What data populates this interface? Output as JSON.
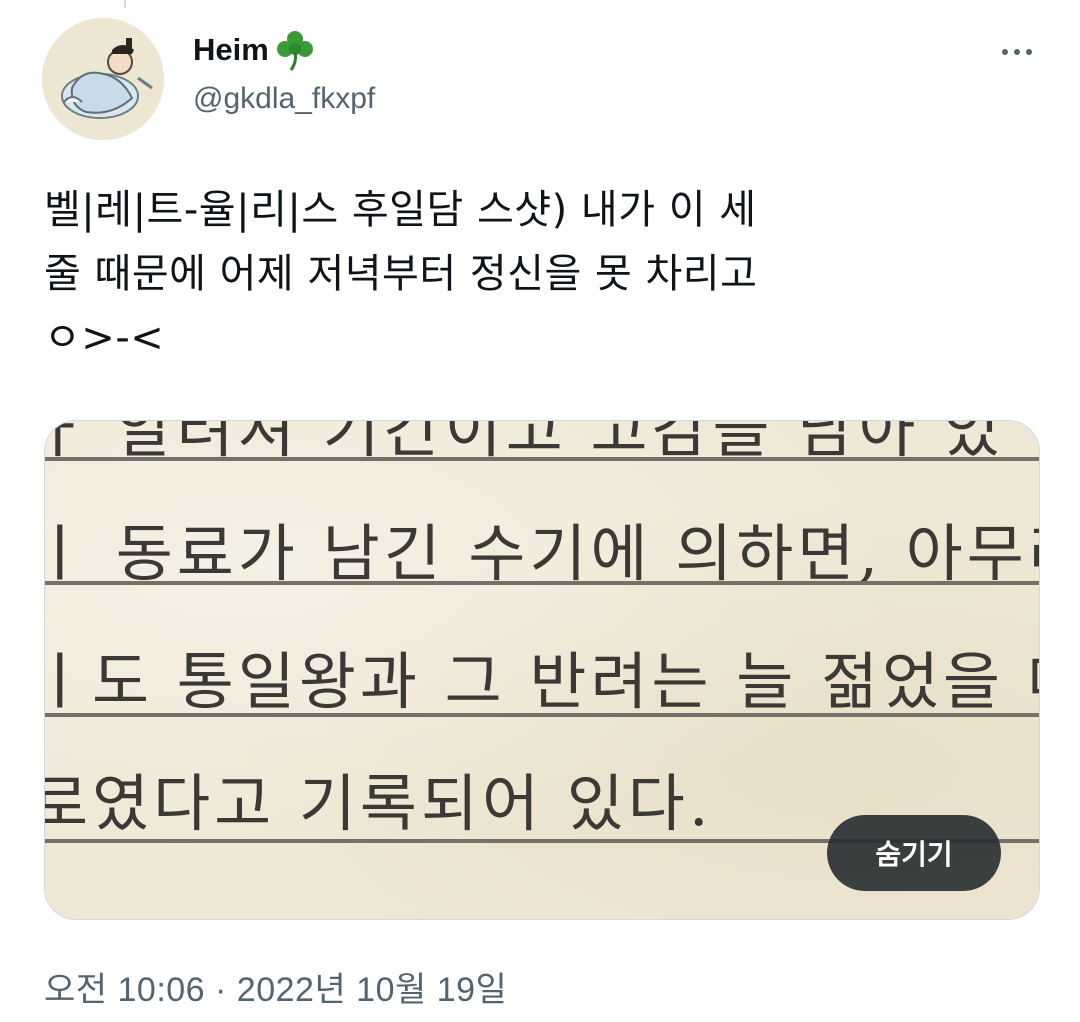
{
  "author": {
    "display_name": "Heim",
    "emoji_icon": "shamrock-icon",
    "handle": "@gkdla_fkxpf"
  },
  "tweet": {
    "text": "벨|레|트-율|리|스 후일담 스샷) 내가 이 세\n줄 때문에 어제 저녁부터 정신을 못 차리고\nㅇ>-<"
  },
  "media": {
    "image_lines": [
      "ㅏ 알려져 기간이고 고감을 남아 있",
      "ㅣ 동료가 남긴 수기에 의하면, 아무리",
      "ㅣ도 통일왕과 그 반려는 늘 젊었을 때",
      "로였다고 기록되어 있다."
    ],
    "hide_button_label": "숨기기"
  },
  "timestamp": "오전 10:06 · 2022년 10월 19일",
  "colors": {
    "text_primary": "#0f1419",
    "text_secondary": "#536471",
    "border": "#cfd9de",
    "paper": "#efe8d6",
    "ink": "#3c3835",
    "button_bg": "#272c30"
  }
}
